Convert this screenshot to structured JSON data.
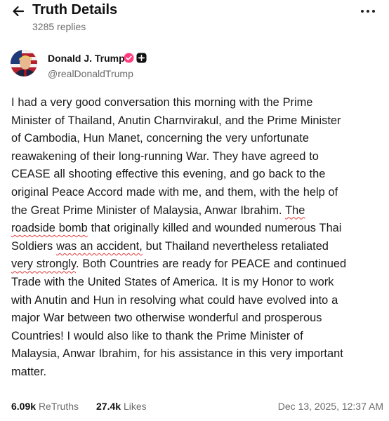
{
  "header": {
    "title": "Truth Details",
    "replies": "3285 replies"
  },
  "author": {
    "name": "Donald J. Trump",
    "handle": "@realDonaldTrump"
  },
  "post": {
    "lines": [
      "I had a very good conversation this morning with the Prime",
      "Minister of Thailand, Anutin Charnvirakul, and the Prime Minister",
      "of Cambodia, Hun Manet, concerning the very unfortunate",
      "reawakening of their long-running War. They have agreed to",
      "CEASE all shooting effective this evening, and go back to the",
      "original Peace Accord made with me, and them, with the help of",
      "the Great Prime Minister of Malaysia, Anwar Ibrahim. ",
      "The",
      "roadside bomb",
      " that originally killed and wounded numerous Thai",
      "Soldiers ",
      "was an accident,",
      " but Thailand nevertheless retaliated",
      "very strongly",
      ". Both Countries are ready for PEACE and continued",
      "Trade with the United States of America. It is my Honor to work",
      "with Anutin and Hun in resolving what could have evolved into a",
      "major War between two otherwise wonderful and prosperous",
      "Countries! I would also like to thank the Prime Minister of",
      "Malaysia, Anwar Ibrahim, for his assistance in this very important",
      "matter."
    ]
  },
  "stats": {
    "retruths_count": "6.09k",
    "retruths_label": "ReTruths",
    "likes_count": "27.4k",
    "likes_label": "Likes",
    "timestamp": "Dec 13, 2025, 12:37 AM"
  },
  "colors": {
    "verified_badge": "#ff3d7f",
    "annotation_underline": "#e23b3b",
    "secondary_text": "#6b6b6b"
  },
  "icons": {
    "back": "arrow-left-icon",
    "more": "ellipsis-icon",
    "verified": "verified-badge-icon",
    "plus": "plus-badge-icon"
  }
}
